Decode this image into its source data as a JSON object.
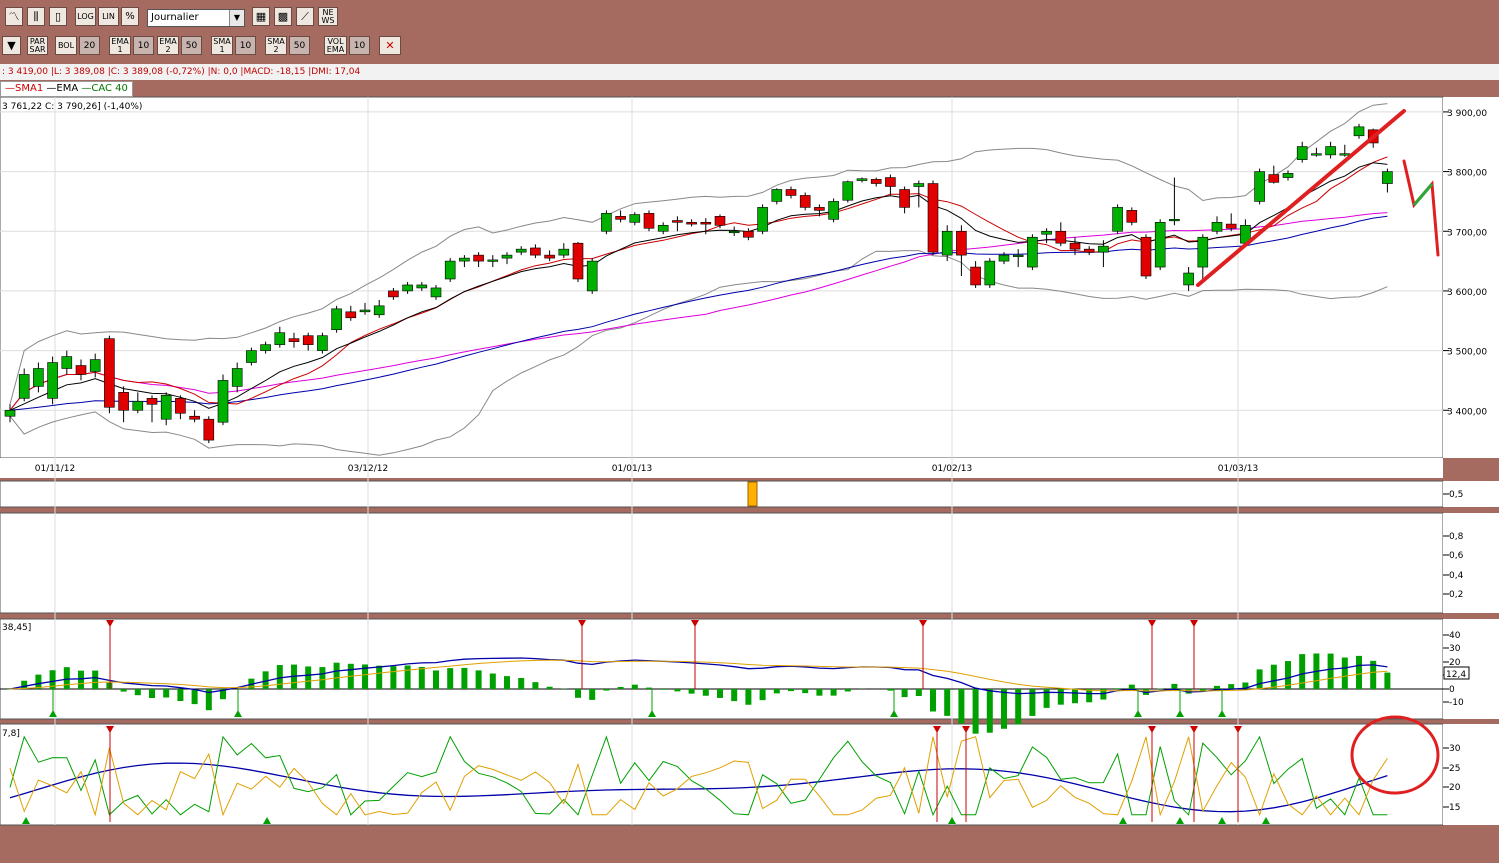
{
  "toolbar1": {
    "log": "LOG",
    "lin": "LIN",
    "pct": "%",
    "period": "Journalier",
    "news_top": "NE",
    "news_bottom": "WS"
  },
  "toolbar2": {
    "parsar_top": "PAR",
    "parsar_bottom": "SAR",
    "bol": "BOL",
    "bol_value": "20",
    "ema1_top": "EMA",
    "ema1_bottom": "1",
    "ema1_value": "10",
    "ema2_top": "EMA",
    "ema2_bottom": "2",
    "ema2_value": "50",
    "sma1_top": "SMA",
    "sma1_bottom": "1",
    "sma1_value": "10",
    "sma2_top": "SMA",
    "sma2_bottom": "2",
    "sma2_value": "50",
    "volema_top": "VOL",
    "volema_bottom": "EMA",
    "volema_value": "10"
  },
  "info_line": ": 3 419,00 |L: 3 389,08 |C: 3 389,08 (-0,72%) |N: 0,0 |MACD: -18,15 |DMI: 17,04",
  "legend": {
    "sma": "SMA1",
    "ema": "EMA",
    "index": "CAC 40"
  },
  "price_info": "3 761,22  C: 3 790,26] (-1,40%)",
  "macd_label": "38,45]",
  "dmi_label": "7,8]",
  "macd_value_badge": "12,4",
  "colors": {
    "up": "#00b000",
    "down": "#e00000",
    "background": "#a56b61",
    "sma": "#cc0000",
    "ema": "#000000",
    "ema50": "#0000aa",
    "sma50": "#dd00dd",
    "bollinger": "#888888"
  },
  "chart_data": [
    {
      "type": "candlestick",
      "title": "CAC 40",
      "x_tick_labels": [
        "01/11/12",
        "03/12/12",
        "01/01/13",
        "01/02/13",
        "01/03/13"
      ],
      "y_tick_labels": [
        "3 900,00",
        "3 800,00",
        "3 700,00",
        "3 600,00",
        "3 500,00",
        "3 400,00"
      ],
      "ylim": [
        3320,
        3925
      ],
      "candles": [
        {
          "o": 3390,
          "c": 3400,
          "h": 3410,
          "l": 3380
        },
        {
          "o": 3420,
          "c": 3460,
          "h": 3470,
          "l": 3415
        },
        {
          "o": 3440,
          "c": 3470,
          "h": 3480,
          "l": 3430
        },
        {
          "o": 3420,
          "c": 3480,
          "h": 3490,
          "l": 3410
        },
        {
          "o": 3470,
          "c": 3490,
          "h": 3500,
          "l": 3460
        },
        {
          "o": 3475,
          "c": 3460,
          "h": 3485,
          "l": 3450
        },
        {
          "o": 3465,
          "c": 3485,
          "h": 3495,
          "l": 3455
        },
        {
          "o": 3520,
          "c": 3405,
          "h": 3525,
          "l": 3395
        },
        {
          "o": 3430,
          "c": 3400,
          "h": 3440,
          "l": 3380
        },
        {
          "o": 3400,
          "c": 3415,
          "h": 3430,
          "l": 3395
        },
        {
          "o": 3420,
          "c": 3410,
          "h": 3425,
          "l": 3380
        },
        {
          "o": 3385,
          "c": 3425,
          "h": 3430,
          "l": 3375
        },
        {
          "o": 3420,
          "c": 3395,
          "h": 3425,
          "l": 3385
        },
        {
          "o": 3390,
          "c": 3385,
          "h": 3400,
          "l": 3380
        },
        {
          "o": 3385,
          "c": 3350,
          "h": 3390,
          "l": 3345
        },
        {
          "o": 3380,
          "c": 3450,
          "h": 3460,
          "l": 3375
        },
        {
          "o": 3440,
          "c": 3470,
          "h": 3480,
          "l": 3430
        },
        {
          "o": 3480,
          "c": 3500,
          "h": 3505,
          "l": 3475
        },
        {
          "o": 3500,
          "c": 3510,
          "h": 3515,
          "l": 3495
        },
        {
          "o": 3510,
          "c": 3530,
          "h": 3540,
          "l": 3505
        },
        {
          "o": 3520,
          "c": 3515,
          "h": 3530,
          "l": 3505
        },
        {
          "o": 3525,
          "c": 3510,
          "h": 3530,
          "l": 3500
        },
        {
          "o": 3500,
          "c": 3525,
          "h": 3530,
          "l": 3495
        },
        {
          "o": 3535,
          "c": 3570,
          "h": 3575,
          "l": 3530
        },
        {
          "o": 3565,
          "c": 3555,
          "h": 3575,
          "l": 3550
        },
        {
          "o": 3565,
          "c": 3568,
          "h": 3580,
          "l": 3560
        },
        {
          "o": 3560,
          "c": 3575,
          "h": 3585,
          "l": 3555
        },
        {
          "o": 3600,
          "c": 3590,
          "h": 3605,
          "l": 3585
        },
        {
          "o": 3600,
          "c": 3610,
          "h": 3615,
          "l": 3595
        },
        {
          "o": 3605,
          "c": 3610,
          "h": 3615,
          "l": 3600
        },
        {
          "o": 3590,
          "c": 3605,
          "h": 3610,
          "l": 3585
        },
        {
          "o": 3620,
          "c": 3650,
          "h": 3655,
          "l": 3615
        },
        {
          "o": 3650,
          "c": 3655,
          "h": 3660,
          "l": 3640
        },
        {
          "o": 3660,
          "c": 3650,
          "h": 3665,
          "l": 3640
        },
        {
          "o": 3650,
          "c": 3652,
          "h": 3660,
          "l": 3640
        },
        {
          "o": 3655,
          "c": 3660,
          "h": 3665,
          "l": 3645
        },
        {
          "o": 3665,
          "c": 3670,
          "h": 3675,
          "l": 3660
        },
        {
          "o": 3672,
          "c": 3660,
          "h": 3678,
          "l": 3655
        },
        {
          "o": 3660,
          "c": 3655,
          "h": 3668,
          "l": 3650
        },
        {
          "o": 3660,
          "c": 3670,
          "h": 3680,
          "l": 3655
        },
        {
          "o": 3680,
          "c": 3620,
          "h": 3682,
          "l": 3615
        },
        {
          "o": 3600,
          "c": 3650,
          "h": 3655,
          "l": 3595
        },
        {
          "o": 3700,
          "c": 3730,
          "h": 3735,
          "l": 3695
        },
        {
          "o": 3725,
          "c": 3720,
          "h": 3735,
          "l": 3715
        },
        {
          "o": 3715,
          "c": 3728,
          "h": 3732,
          "l": 3710
        },
        {
          "o": 3730,
          "c": 3705,
          "h": 3735,
          "l": 3700
        },
        {
          "o": 3700,
          "c": 3710,
          "h": 3715,
          "l": 3695
        },
        {
          "o": 3718,
          "c": 3715,
          "h": 3725,
          "l": 3700
        },
        {
          "o": 3715,
          "c": 3712,
          "h": 3720,
          "l": 3708
        },
        {
          "o": 3715,
          "c": 3712,
          "h": 3722,
          "l": 3695
        },
        {
          "o": 3725,
          "c": 3710,
          "h": 3728,
          "l": 3705
        },
        {
          "o": 3700,
          "c": 3700,
          "h": 3708,
          "l": 3692
        },
        {
          "o": 3700,
          "c": 3690,
          "h": 3705,
          "l": 3685
        },
        {
          "o": 3700,
          "c": 3740,
          "h": 3745,
          "l": 3695
        },
        {
          "o": 3750,
          "c": 3770,
          "h": 3772,
          "l": 3745
        },
        {
          "o": 3770,
          "c": 3760,
          "h": 3775,
          "l": 3755
        },
        {
          "o": 3760,
          "c": 3740,
          "h": 3765,
          "l": 3735
        },
        {
          "o": 3740,
          "c": 3735,
          "h": 3745,
          "l": 3725
        },
        {
          "o": 3720,
          "c": 3750,
          "h": 3755,
          "l": 3715
        },
        {
          "o": 3752,
          "c": 3783,
          "h": 3785,
          "l": 3748
        },
        {
          "o": 3785,
          "c": 3788,
          "h": 3790,
          "l": 3782
        },
        {
          "o": 3787,
          "c": 3780,
          "h": 3790,
          "l": 3775
        },
        {
          "o": 3790,
          "c": 3775,
          "h": 3795,
          "l": 3760
        },
        {
          "o": 3770,
          "c": 3740,
          "h": 3775,
          "l": 3730
        },
        {
          "o": 3775,
          "c": 3780,
          "h": 3785,
          "l": 3740
        },
        {
          "o": 3780,
          "c": 3665,
          "h": 3785,
          "l": 3660
        },
        {
          "o": 3660,
          "c": 3700,
          "h": 3710,
          "l": 3650
        },
        {
          "o": 3700,
          "c": 3660,
          "h": 3710,
          "l": 3625
        },
        {
          "o": 3640,
          "c": 3610,
          "h": 3650,
          "l": 3605
        },
        {
          "o": 3610,
          "c": 3650,
          "h": 3655,
          "l": 3605
        },
        {
          "o": 3650,
          "c": 3660,
          "h": 3665,
          "l": 3645
        },
        {
          "o": 3660,
          "c": 3660,
          "h": 3670,
          "l": 3640
        },
        {
          "o": 3640,
          "c": 3690,
          "h": 3695,
          "l": 3635
        },
        {
          "o": 3695,
          "c": 3700,
          "h": 3705,
          "l": 3680
        },
        {
          "o": 3700,
          "c": 3680,
          "h": 3715,
          "l": 3675
        },
        {
          "o": 3680,
          "c": 3670,
          "h": 3690,
          "l": 3660
        },
        {
          "o": 3670,
          "c": 3665,
          "h": 3675,
          "l": 3660
        },
        {
          "o": 3665,
          "c": 3675,
          "h": 3685,
          "l": 3640
        },
        {
          "o": 3700,
          "c": 3740,
          "h": 3745,
          "l": 3695
        },
        {
          "o": 3735,
          "c": 3715,
          "h": 3740,
          "l": 3710
        },
        {
          "o": 3690,
          "c": 3625,
          "h": 3695,
          "l": 3620
        },
        {
          "o": 3640,
          "c": 3715,
          "h": 3720,
          "l": 3635
        },
        {
          "o": 3720,
          "c": 3720,
          "h": 3790,
          "l": 3710
        },
        {
          "o": 3610,
          "c": 3630,
          "h": 3640,
          "l": 3600
        },
        {
          "o": 3640,
          "c": 3690,
          "h": 3695,
          "l": 3620
        },
        {
          "o": 3700,
          "c": 3715,
          "h": 3725,
          "l": 3695
        },
        {
          "o": 3712,
          "c": 3705,
          "h": 3730,
          "l": 3700
        },
        {
          "o": 3680,
          "c": 3710,
          "h": 3720,
          "l": 3675
        },
        {
          "o": 3750,
          "c": 3800,
          "h": 3805,
          "l": 3745
        },
        {
          "o": 3795,
          "c": 3782,
          "h": 3810,
          "l": 3780
        },
        {
          "o": 3790,
          "c": 3797,
          "h": 3802,
          "l": 3785
        },
        {
          "o": 3820,
          "c": 3842,
          "h": 3850,
          "l": 3815
        },
        {
          "o": 3830,
          "c": 3830,
          "h": 3840,
          "l": 3825
        },
        {
          "o": 3828,
          "c": 3842,
          "h": 3850,
          "l": 3822
        },
        {
          "o": 3830,
          "c": 3830,
          "h": 3845,
          "l": 3825
        },
        {
          "o": 3860,
          "c": 3875,
          "h": 3880,
          "l": 3855
        },
        {
          "o": 3870,
          "c": 3848,
          "h": 3872,
          "l": 3840
        },
        {
          "o": 3780,
          "c": 3800,
          "h": 3805,
          "l": 3765
        }
      ]
    }
  ]
}
